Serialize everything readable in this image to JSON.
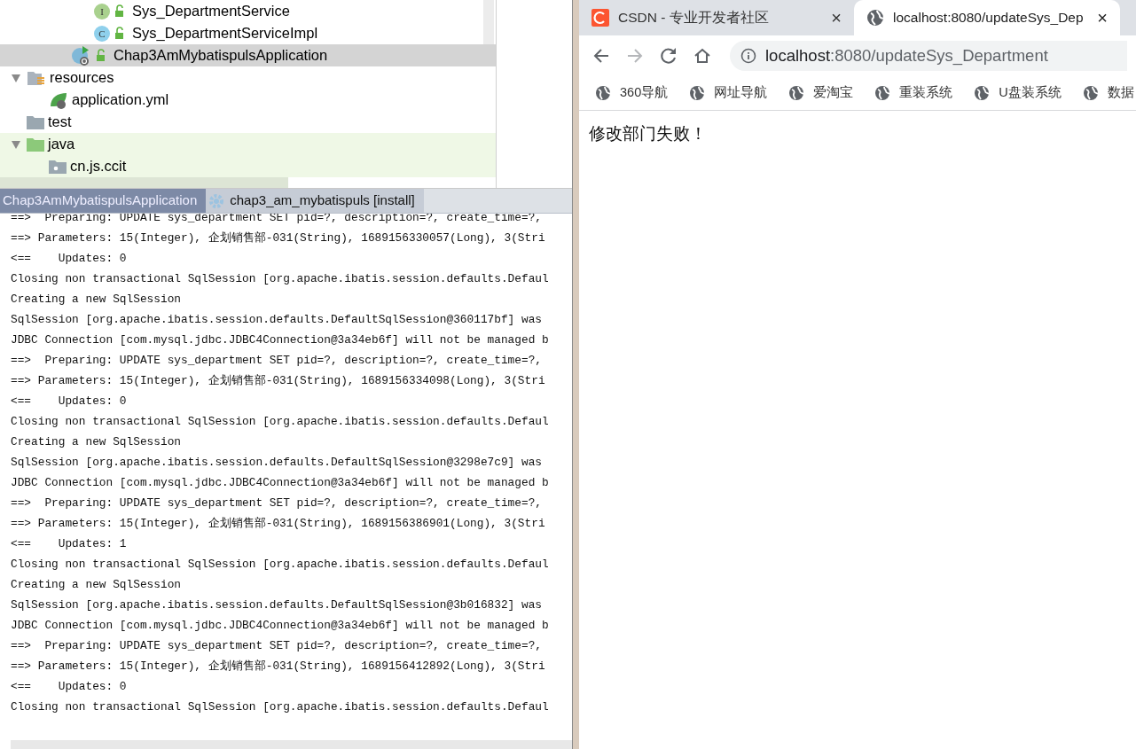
{
  "project_tree": [
    {
      "kind": "hidden",
      "children": [
        {
          "kind": "hidden",
          "children": [
            {
              "kind": "hidden",
              "children": [
                {
                  "kind": "interface",
                  "icon_letter": "I",
                  "label": "Sys_DepartmentService",
                  "selected": false,
                  "test_source": false
                },
                {
                  "kind": "class",
                  "icon_letter": "C",
                  "label": "Sys_DepartmentServiceImpl",
                  "selected": false,
                  "test_source": false
                }
              ]
            },
            {
              "kind": "application",
              "label": "Chap3AmMybatispulsApplication",
              "selected": true,
              "test_source": false
            }
          ]
        }
      ]
    },
    {
      "kind": "resources",
      "label": "resources",
      "expanded": true,
      "selected": false,
      "test_source": false,
      "children": [
        {
          "kind": "yaml",
          "label": "application.yml",
          "selected": false,
          "test_source": false
        }
      ]
    },
    {
      "kind": "folder",
      "label": "test",
      "selected": false,
      "test_source": false
    },
    {
      "kind": "source-folder",
      "label": "java",
      "expanded": true,
      "selected": false,
      "test_source": true,
      "children": [
        {
          "kind": "package",
          "label": "cn.js.ccit",
          "selected": false,
          "test_source": true
        }
      ]
    }
  ],
  "run_tabs": [
    {
      "label": "Chap3AmMybatispulsApplication",
      "kind": "app",
      "selected": true
    },
    {
      "label": "chap3_am_mybatispuls [install]",
      "kind": "maven",
      "selected": false
    }
  ],
  "console_lines": [
    "==>  Preparing: UPDATE sys_department SET pid=?, description=?, create_time=?,",
    "==> Parameters: 15(Integer), 企划销售部-031(String), 1689156330057(Long), 3(Stri",
    "<==    Updates: 0",
    "Closing non transactional SqlSession [org.apache.ibatis.session.defaults.Defaul",
    "Creating a new SqlSession",
    "SqlSession [org.apache.ibatis.session.defaults.DefaultSqlSession@360117bf] was",
    "JDBC Connection [com.mysql.jdbc.JDBC4Connection@3a34eb6f] will not be managed b",
    "==>  Preparing: UPDATE sys_department SET pid=?, description=?, create_time=?,",
    "==> Parameters: 15(Integer), 企划销售部-031(String), 1689156334098(Long), 3(Stri",
    "<==    Updates: 0",
    "Closing non transactional SqlSession [org.apache.ibatis.session.defaults.Defaul",
    "Creating a new SqlSession",
    "SqlSession [org.apache.ibatis.session.defaults.DefaultSqlSession@3298e7c9] was",
    "JDBC Connection [com.mysql.jdbc.JDBC4Connection@3a34eb6f] will not be managed b",
    "==>  Preparing: UPDATE sys_department SET pid=?, description=?, create_time=?,",
    "==> Parameters: 15(Integer), 企划销售部-031(String), 1689156386901(Long), 3(Stri",
    "<==    Updates: 1",
    "Closing non transactional SqlSession [org.apache.ibatis.session.defaults.Defaul",
    "Creating a new SqlSession",
    "SqlSession [org.apache.ibatis.session.defaults.DefaultSqlSession@3b016832] was",
    "JDBC Connection [com.mysql.jdbc.JDBC4Connection@3a34eb6f] will not be managed b",
    "==>  Preparing: UPDATE sys_department SET pid=?, description=?, create_time=?,",
    "==> Parameters: 15(Integer), 企划销售部-031(String), 1689156412892(Long), 3(Stri",
    "<==    Updates: 0",
    "Closing non transactional SqlSession [org.apache.ibatis.session.defaults.Defaul"
  ],
  "browser": {
    "tabs": [
      {
        "title": "CSDN - 专业开发者社区",
        "kind": "csdn",
        "selected": false,
        "close": "×"
      },
      {
        "title": "localhost:8080/updateSys_Dep",
        "kind": "globe",
        "selected": true,
        "close": "×"
      }
    ],
    "nav_buttons": [
      {
        "kind": "back",
        "disabled": false
      },
      {
        "kind": "forward",
        "disabled": true
      },
      {
        "kind": "reload",
        "disabled": false
      },
      {
        "kind": "home",
        "disabled": false
      }
    ],
    "address": {
      "host": "localhost",
      "path": ":8080/updateSys_Department"
    },
    "bookmarks": [
      "360导航",
      "网址导航",
      "爱淘宝",
      "重装系统",
      "U盘装系统",
      "数据"
    ],
    "page_text": "修改部门失败！"
  }
}
